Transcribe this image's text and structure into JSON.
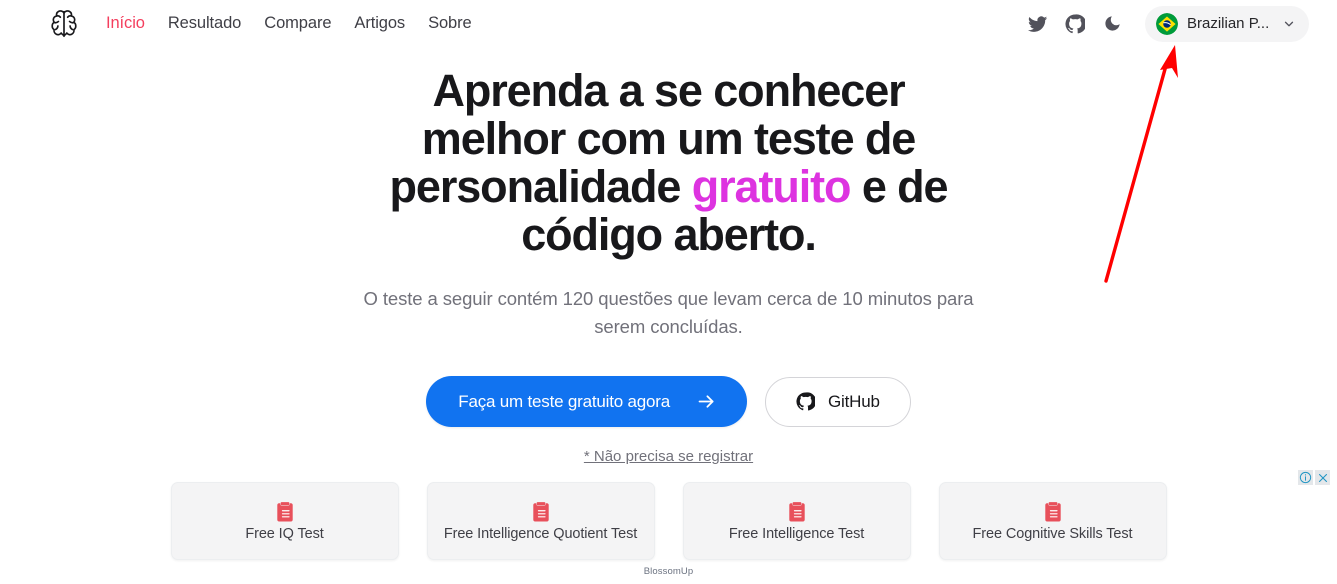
{
  "header": {
    "logo_name": "brain-logo",
    "nav": [
      {
        "label": "Início",
        "active": true
      },
      {
        "label": "Resultado",
        "active": false
      },
      {
        "label": "Compare",
        "active": false
      },
      {
        "label": "Artigos",
        "active": false
      },
      {
        "label": "Sobre",
        "active": false
      }
    ],
    "icons": [
      {
        "name": "twitter-icon"
      },
      {
        "name": "github-icon"
      },
      {
        "name": "dark-mode-moon-icon"
      }
    ],
    "language": {
      "flag": "brazil-flag-icon",
      "label": "Brazilian P...",
      "chevron": "chevron-down-icon"
    }
  },
  "hero": {
    "headline_part1": "Aprenda a se conhecer melhor com um teste de personalidade ",
    "headline_highlight": "gratuito",
    "headline_part2": " e de código aberto.",
    "subtitle": "O teste a seguir contém 120 questões que levam cerca de 10 minutos para serem concluídas.",
    "primary_button": "Faça um teste gratuito agora",
    "primary_button_icon": "arrow-right-icon",
    "secondary_button": "GitHub",
    "secondary_button_icon": "github-icon",
    "note": "* Não precisa se registrar"
  },
  "ad": {
    "cards": [
      {
        "title": "Free IQ Test",
        "icon": "clipboard-icon"
      },
      {
        "title": "Free Intelligence Quotient Test",
        "icon": "clipboard-icon"
      },
      {
        "title": "Free Intelligence Test",
        "icon": "clipboard-icon"
      },
      {
        "title": "Free Cognitive Skills Test",
        "icon": "clipboard-icon"
      }
    ],
    "brand": "BlossomUp",
    "info_icon": "ad-info-icon",
    "close_icon": "ad-close-icon"
  },
  "annotation": {
    "name": "red-arrow-pointing-to-language-selector",
    "color": "#ff0000"
  },
  "colors": {
    "accent_pink": "#f43f5e",
    "highlight_magenta": "#dd33e0",
    "primary_blue": "#1173f0",
    "annotation_red": "#ff0000"
  }
}
